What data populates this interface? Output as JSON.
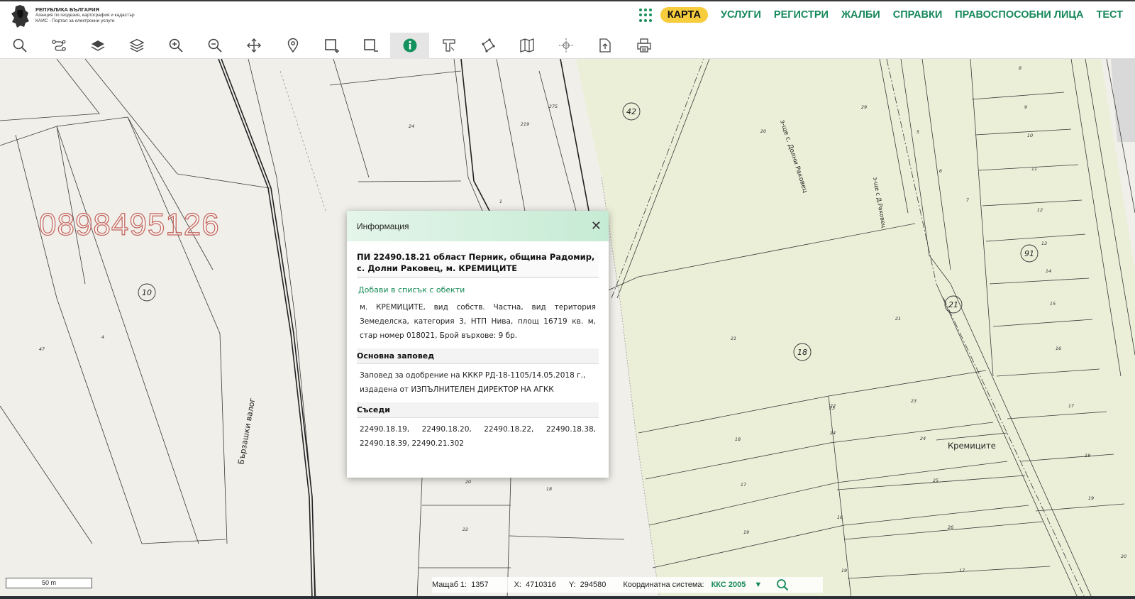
{
  "logo": {
    "line1": "РЕПУБЛИКА БЪЛГАРИЯ",
    "line2": "Агенция по геодезия, картография и кадастър",
    "line3": "КАИС - Портал за електронни услуги"
  },
  "nav": {
    "items": [
      {
        "label": "КАРТА",
        "active": true
      },
      {
        "label": "УСЛУГИ"
      },
      {
        "label": "РЕГИСТРИ"
      },
      {
        "label": "ЖАЛБИ"
      },
      {
        "label": "СПРАВКИ"
      },
      {
        "label": "ПРАВОСПОСОБНИ ЛИЦА"
      },
      {
        "label": "ТЕСТ"
      }
    ]
  },
  "toolbar": {
    "tools": [
      "search-icon",
      "route-icon",
      "layer-icon",
      "layers-icon",
      "zoom-in-icon",
      "zoom-out-icon",
      "pan-icon",
      "location-pin-icon",
      "select-add-icon",
      "select-remove-icon",
      "info-icon",
      "measure-icon",
      "polygon-icon",
      "map-book-icon",
      "coordinates-icon",
      "export-icon",
      "print-icon"
    ],
    "active_tool": "info-icon"
  },
  "watermark": "0898495126",
  "map_labels": {
    "street_left": "Бързашки валог",
    "street_right1": "з-ще с. Долни Раковец",
    "street_right2": "з-ще с Д.Раковец",
    "place": "Кремиците",
    "block_42": "42",
    "block_10": "10",
    "block_91": "91",
    "block_21": "21",
    "block_18": "18",
    "parcels": [
      "24",
      "219",
      "275",
      "1",
      "4",
      "47",
      "21",
      "20",
      "29",
      "5",
      "6",
      "7",
      "8",
      "9",
      "10",
      "11",
      "12",
      "13",
      "14",
      "15",
      "16",
      "17",
      "18",
      "19",
      "20",
      "21",
      "22",
      "23",
      "24",
      "25",
      "26",
      "17",
      "16",
      "19",
      "18",
      "17",
      "19",
      "20",
      "18",
      "22",
      "23",
      "24"
    ]
  },
  "popup": {
    "title": "Информация",
    "close": "✕",
    "heading": "ПИ 22490.18.21 област Перник, община Радомир, с. Долни Раковец, м. КРЕМИЦИТЕ",
    "add_link": "Добави в списък с обекти",
    "details": "м. КРЕМИЦИТЕ, вид собств. Частна, вид територия Земеделска, категория 3, НТП Нива, площ 16719 кв. м, стар номер 018021, Брой върхове: 9 бр.",
    "order_heading": "Основна заповед",
    "order_text": "Заповед за одобрение на КККР РД-18-1105/14.05.2018 г., издадена от ИЗПЪЛНИТЕЛЕН ДИРЕКТОР НА АГКК",
    "neighbors_heading": "Съседи",
    "neighbors_row1": [
      "22490.18.19,",
      "22490.18.20,",
      "22490.18.22,",
      "22490.18.38,"
    ],
    "neighbors_row2": "22490.18.39, 22490.21.302"
  },
  "scalebar": "50 m",
  "status": {
    "scale_label": "Мащаб 1:",
    "scale_value": "1357",
    "x_label": "X:",
    "x_value": "4710316",
    "y_label": "Y:",
    "y_value": "294580",
    "cs_label": "Координатна система:",
    "cs_value": "ККС 2005",
    "dropdown": "▼"
  },
  "colors": {
    "accent": "#15885a",
    "active_nav": "#f7cc3d",
    "map_bg": "#f0efea",
    "farmland": "#ecefd8",
    "watermark": "#c4625a"
  }
}
